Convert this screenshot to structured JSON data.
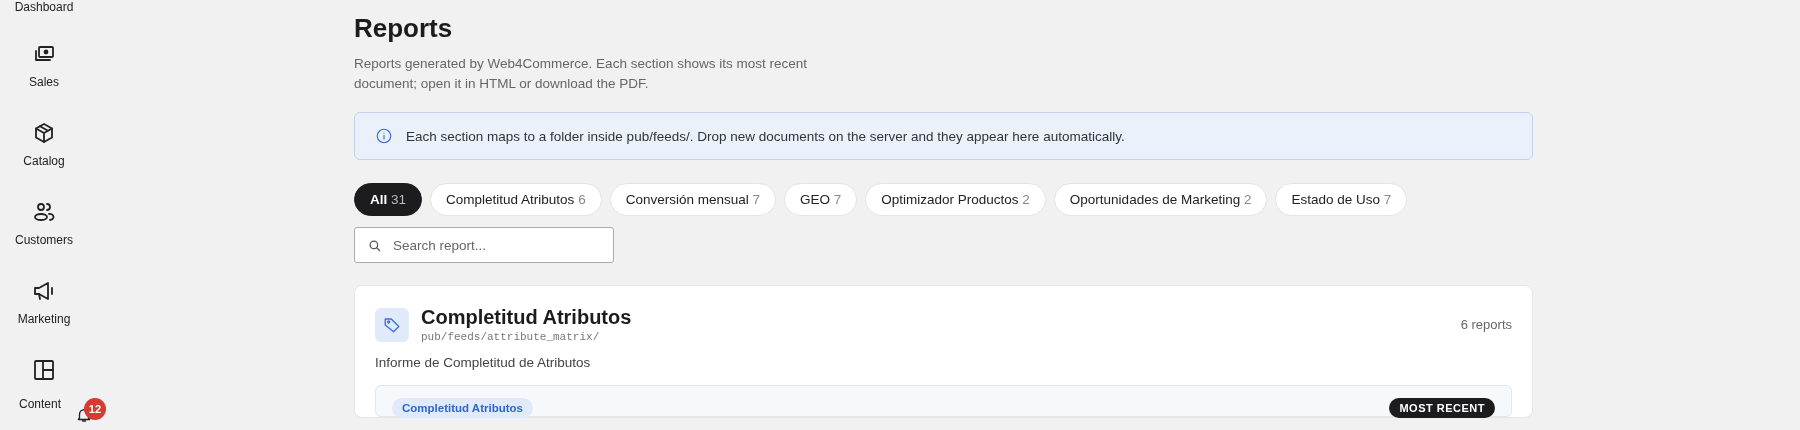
{
  "sidebar": {
    "items": [
      {
        "label": "Dashboard"
      },
      {
        "label": "Sales"
      },
      {
        "label": "Catalog"
      },
      {
        "label": "Customers"
      },
      {
        "label": "Marketing"
      },
      {
        "label": "Content"
      }
    ],
    "notifications": {
      "count": "12"
    }
  },
  "page": {
    "title": "Reports",
    "subtitle": "Reports generated by Web4Commerce. Each section shows its most recent document; open it in HTML or download the PDF."
  },
  "info_banner": {
    "text": "Each section maps to a folder inside pub/feeds/. Drop new documents on the server and they appear here automatically."
  },
  "filters": [
    {
      "label": "All",
      "count": "31",
      "selected": true
    },
    {
      "label": "Completitud Atributos",
      "count": "6",
      "selected": false
    },
    {
      "label": "Conversión mensual",
      "count": "7",
      "selected": false
    },
    {
      "label": "GEO",
      "count": "7",
      "selected": false
    },
    {
      "label": "Optimizador Productos",
      "count": "2",
      "selected": false
    },
    {
      "label": "Oportunidades de Marketing",
      "count": "2",
      "selected": false
    },
    {
      "label": "Estado de Uso",
      "count": "7",
      "selected": false
    }
  ],
  "search": {
    "placeholder": "Search report..."
  },
  "sections": [
    {
      "title": "Completitud Atributos",
      "path": "pub/feeds/attribute_matrix/",
      "report_count": "6 reports",
      "description": "Informe de Completitud de Atributos",
      "latest": {
        "tag": "Completitud Atributos",
        "badge": "MOST RECENT"
      }
    }
  ]
}
